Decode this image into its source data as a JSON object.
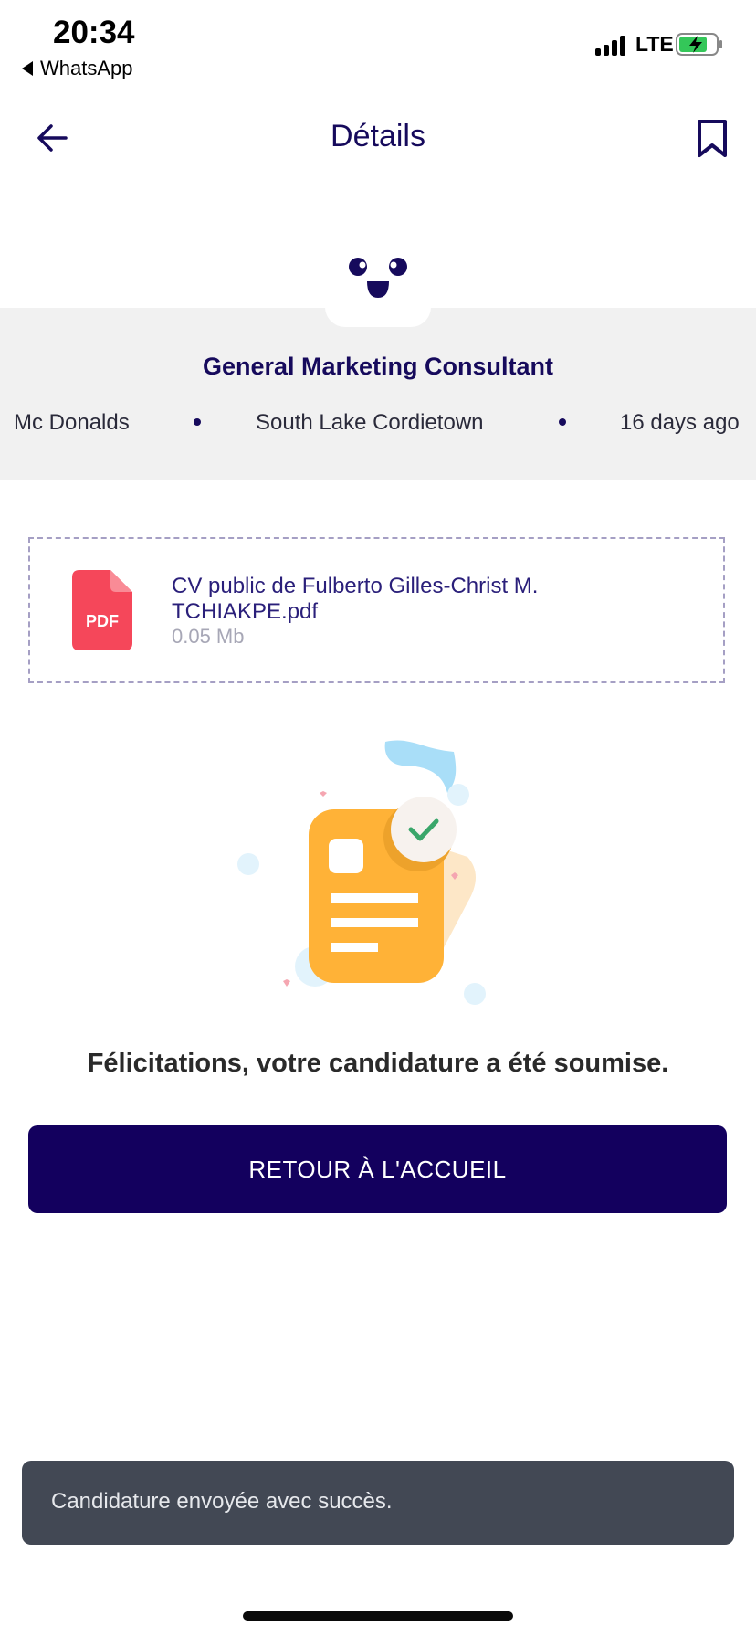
{
  "status_bar": {
    "time": "20:34",
    "back_app": "WhatsApp",
    "network": "LTE"
  },
  "nav": {
    "title": "Détails"
  },
  "job": {
    "title": "General Marketing Consultant",
    "company": "Mc Donalds",
    "location": "South Lake Cordietown",
    "posted": "16 days ago"
  },
  "file": {
    "icon_label": "PDF",
    "name": "CV public de Fulberto Gilles-Christ M. TCHIAKPE.pdf",
    "size": "0.05 Mb"
  },
  "success_message": "Félicitations, votre candidature a été soumise.",
  "home_button_label": "RETOUR À L'ACCUEIL",
  "snackbar": {
    "message": "Candidature envoyée avec succès."
  },
  "colors": {
    "primary": "#13005e",
    "snackbar": "#424854",
    "pdf": "#f5475a",
    "accent_orange": "#ffb237",
    "check_green": "#3aa66a"
  }
}
